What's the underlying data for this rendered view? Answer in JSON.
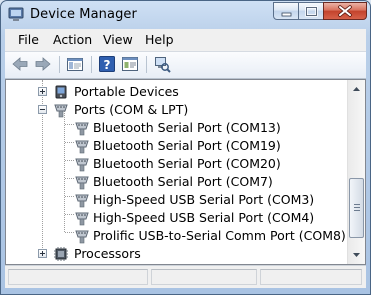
{
  "window": {
    "title": "Device Manager"
  },
  "menu": [
    {
      "label": "File"
    },
    {
      "label": "Action"
    },
    {
      "label": "View"
    },
    {
      "label": "Help"
    }
  ],
  "toolbar": {
    "buttons": [
      "back-arrow-icon",
      "forward-arrow-icon",
      "show-hide-console-tree-icon",
      "help-icon",
      "properties-icon",
      "scan-hardware-icon"
    ]
  },
  "tree": {
    "portable": {
      "label": "Portable Devices"
    },
    "ports": {
      "label": "Ports (COM & LPT)",
      "children": [
        {
          "label": "Bluetooth Serial Port (COM13)"
        },
        {
          "label": "Bluetooth Serial Port (COM19)"
        },
        {
          "label": "Bluetooth Serial Port (COM20)"
        },
        {
          "label": "Bluetooth Serial Port (COM7)"
        },
        {
          "label": "High-Speed USB Serial Port (COM3)"
        },
        {
          "label": "High-Speed USB Serial Port (COM4)"
        },
        {
          "label": "Prolific USB-to-Serial Comm Port (COM8)"
        }
      ]
    },
    "processors": {
      "label": "Processors"
    }
  },
  "colors": {
    "title_bar": "#b9cfe9",
    "close_button": "#c3432c",
    "content_bg": "#ffffff"
  }
}
